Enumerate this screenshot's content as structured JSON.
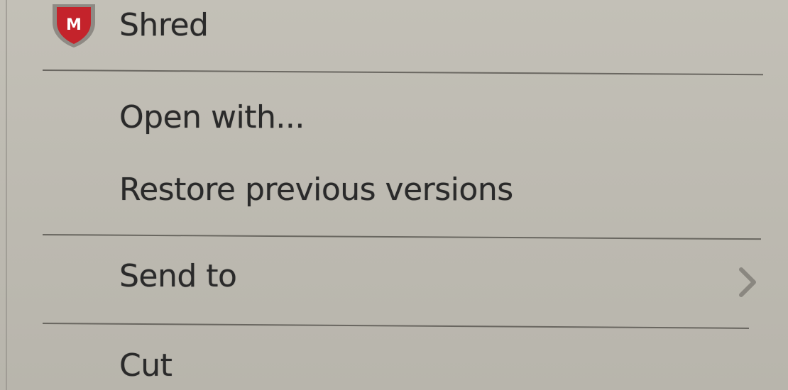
{
  "context_menu": {
    "items": [
      {
        "label": "Shred",
        "icon": "mcafee-shield-icon"
      },
      {
        "label": "Open with..."
      },
      {
        "label": "Restore previous versions"
      },
      {
        "label": "Send to",
        "icon": "chevron-right-icon"
      },
      {
        "label": "Cut"
      }
    ]
  },
  "colors": {
    "menu_background": "#bdbab1",
    "text": "#2a2a2a",
    "separator": "#5a5852",
    "shield_red": "#c4232b"
  }
}
